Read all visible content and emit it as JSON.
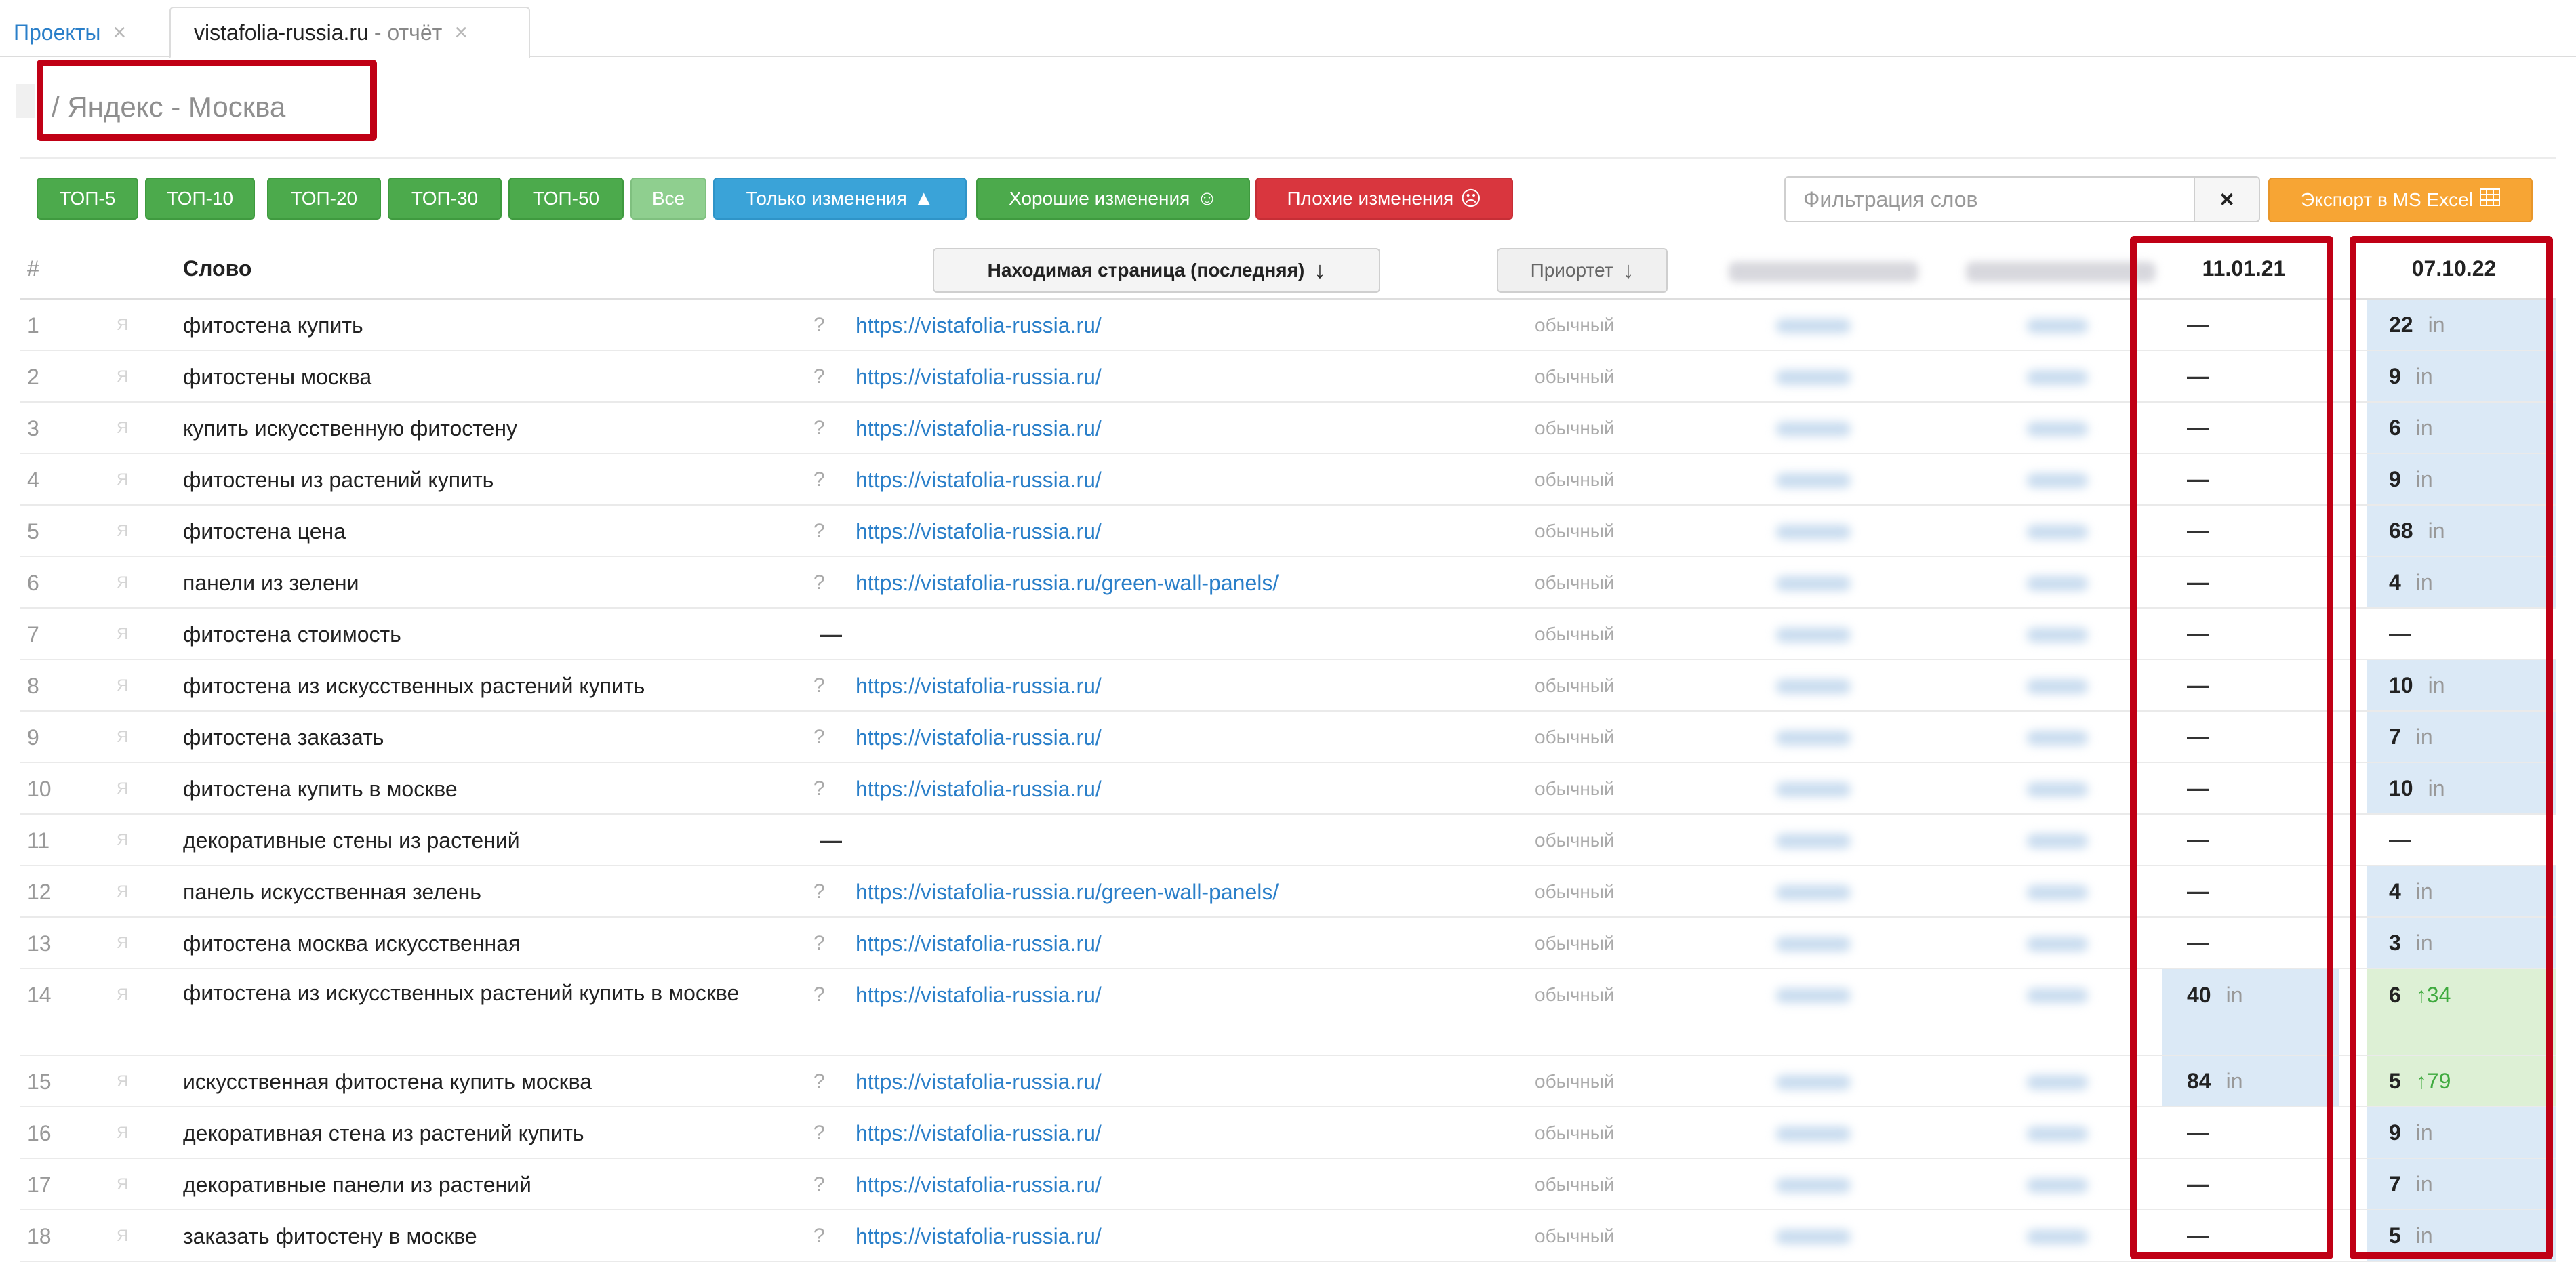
{
  "tabs": [
    {
      "label": "Проекты",
      "close": "×"
    },
    {
      "label": "vistafolia-russia.ru",
      "suffix": "- отчёт",
      "close": "×"
    }
  ],
  "header": {
    "title": "/ Яндекс - Москва"
  },
  "toolbar": {
    "buttons": [
      "ТОП-5",
      "ТОП-10",
      "ТОП-20",
      "ТОП-30",
      "ТОП-50",
      "Все",
      "Только изменения",
      "Хорошие изменения",
      "Плохие изменения"
    ],
    "filter_placeholder": "Фильтрация слов",
    "filter_clear": "×",
    "export_label": "Экспорт в MS Excel"
  },
  "colors": {
    "green": "#4caa4c",
    "blue": "#3aa3d8",
    "red": "#d9363e",
    "orange": "#f7a534",
    "highlight": "#c00015"
  },
  "table": {
    "headers": {
      "num": "#",
      "word": "Слово",
      "page": "Находимая страница (последняя)",
      "priority": "Приортет",
      "date1": "11.01.21",
      "date2": "07.10.22"
    },
    "suffix_in": "in",
    "rows": [
      {
        "n": "1",
        "word": "фитостена купить",
        "q": "?",
        "url": "https://vistafolia-russia.ru/",
        "prio": "обычный",
        "d1": "—",
        "d2": "22",
        "d2_suffix": "in"
      },
      {
        "n": "2",
        "word": "фитостены москва",
        "q": "?",
        "url": "https://vistafolia-russia.ru/",
        "prio": "обычный",
        "d1": "—",
        "d2": "9",
        "d2_suffix": "in"
      },
      {
        "n": "3",
        "word": "купить искусственную фитостену",
        "q": "?",
        "url": "https://vistafolia-russia.ru/",
        "prio": "обычный",
        "d1": "—",
        "d2": "6",
        "d2_suffix": "in"
      },
      {
        "n": "4",
        "word": "фитостены из растений купить",
        "q": "?",
        "url": "https://vistafolia-russia.ru/",
        "prio": "обычный",
        "d1": "—",
        "d2": "9",
        "d2_suffix": "in"
      },
      {
        "n": "5",
        "word": "фитостена цена",
        "q": "?",
        "url": "https://vistafolia-russia.ru/",
        "prio": "обычный",
        "d1": "—",
        "d2": "68",
        "d2_suffix": "in"
      },
      {
        "n": "6",
        "word": "панели из зелени",
        "q": "?",
        "url": "https://vistafolia-russia.ru/green-wall-panels/",
        "prio": "обычный",
        "d1": "—",
        "d2": "4",
        "d2_suffix": "in"
      },
      {
        "n": "7",
        "word": "фитостена стоимость",
        "q": "",
        "url": "—",
        "prio": "обычный",
        "d1": "—",
        "d2": "—",
        "d2_suffix": ""
      },
      {
        "n": "8",
        "word": "фитостена из искусственных растений купить",
        "q": "?",
        "url": "https://vistafolia-russia.ru/",
        "prio": "обычный",
        "d1": "—",
        "d2": "10",
        "d2_suffix": "in"
      },
      {
        "n": "9",
        "word": "фитостена заказать",
        "q": "?",
        "url": "https://vistafolia-russia.ru/",
        "prio": "обычный",
        "d1": "—",
        "d2": "7",
        "d2_suffix": "in"
      },
      {
        "n": "10",
        "word": "фитостена купить в москве",
        "q": "?",
        "url": "https://vistafolia-russia.ru/",
        "prio": "обычный",
        "d1": "—",
        "d2": "10",
        "d2_suffix": "in"
      },
      {
        "n": "11",
        "word": "декоративные стены из растений",
        "q": "",
        "url": "—",
        "prio": "обычный",
        "d1": "—",
        "d2": "—",
        "d2_suffix": ""
      },
      {
        "n": "12",
        "word": "панель искусственная зелень",
        "q": "?",
        "url": "https://vistafolia-russia.ru/green-wall-panels/",
        "prio": "обычный",
        "d1": "—",
        "d2": "4",
        "d2_suffix": "in"
      },
      {
        "n": "13",
        "word": "фитостена москва искусственная",
        "q": "?",
        "url": "https://vistafolia-russia.ru/",
        "prio": "обычный",
        "d1": "—",
        "d2": "3",
        "d2_suffix": "in"
      },
      {
        "n": "14",
        "word": "фитостена из искусственных растений купить в москве",
        "q": "?",
        "url": "https://vistafolia-russia.ru/",
        "prio": "обычный",
        "d1": "40",
        "d1_suffix": "in",
        "d2": "6",
        "d2_change": "↑34"
      },
      {
        "n": "15",
        "word": "искусственная фитостена купить москва",
        "q": "?",
        "url": "https://vistafolia-russia.ru/",
        "prio": "обычный",
        "d1": "84",
        "d1_suffix": "in",
        "d2": "5",
        "d2_change": "↑79"
      },
      {
        "n": "16",
        "word": "декоративная стена из растений купить",
        "q": "?",
        "url": "https://vistafolia-russia.ru/",
        "prio": "обычный",
        "d1": "—",
        "d2": "9",
        "d2_suffix": "in"
      },
      {
        "n": "17",
        "word": "декоративные панели из растений",
        "q": "?",
        "url": "https://vistafolia-russia.ru/",
        "prio": "обычный",
        "d1": "—",
        "d2": "7",
        "d2_suffix": "in"
      },
      {
        "n": "18",
        "word": "заказать фитостену в москве",
        "q": "?",
        "url": "https://vistafolia-russia.ru/",
        "prio": "обычный",
        "d1": "—",
        "d2": "5",
        "d2_suffix": "in"
      }
    ]
  }
}
